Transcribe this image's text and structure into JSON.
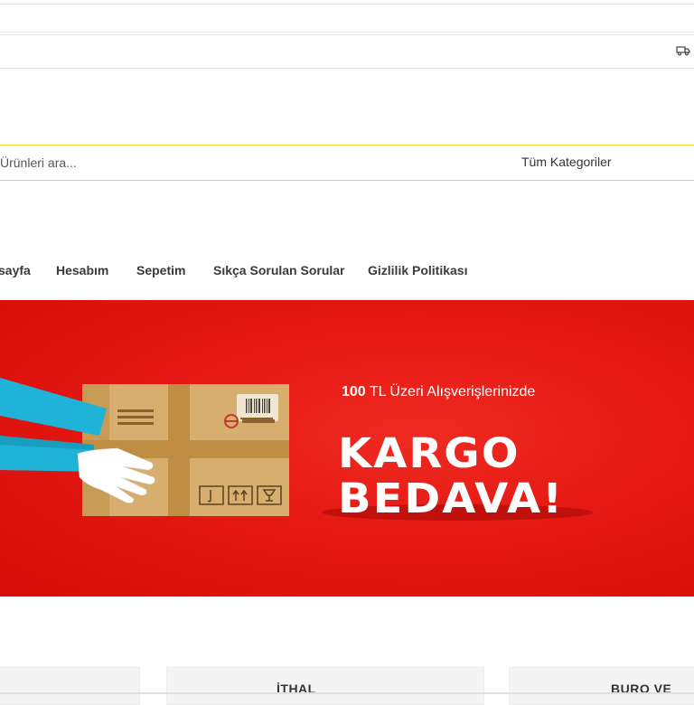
{
  "search": {
    "placeholder": "Ürünleri ara...",
    "category_label": "Tüm Kategoriler"
  },
  "nav": {
    "items": [
      {
        "label": "sayfa"
      },
      {
        "label": "Hesabım"
      },
      {
        "label": "Sepetim"
      },
      {
        "label": "Sıkça Sorulan Sorular"
      },
      {
        "label": "Gizlilik Politikası"
      }
    ]
  },
  "banner": {
    "amount": "100",
    "subtitle_rest": "TL Üzeri Alışverişlerinizde",
    "headline_1": "KARGO",
    "headline_2": "BEDAVA!"
  },
  "cards": [
    {
      "label": ""
    },
    {
      "label": "İTHAL"
    },
    {
      "label": "BURO VE"
    }
  ],
  "colors": {
    "accent_yellow": "#f2d52a",
    "banner_red": "#e51812",
    "box_brown": "#d8ae6e"
  },
  "icons": [
    "truck-icon"
  ]
}
